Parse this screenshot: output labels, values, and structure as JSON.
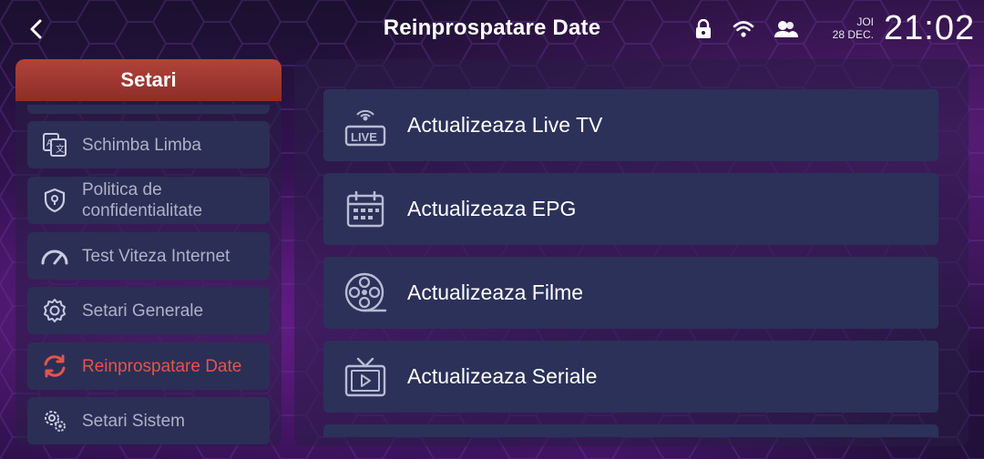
{
  "header": {
    "title": "Reinprospatare Date",
    "back_icon": "chevron-left-icon",
    "status_icons": [
      "lock-icon",
      "wifi-icon",
      "users-icon"
    ],
    "day": "JOI",
    "date": "28 DEC.",
    "time": "21:02"
  },
  "sidebar": {
    "title": "Setari",
    "items": [
      {
        "label": "Schimba Limba",
        "icon": "translate-icon"
      },
      {
        "label": "Politica de confidentialitate",
        "icon": "shield-lock-icon"
      },
      {
        "label": "Test Viteza Internet",
        "icon": "speedometer-icon"
      },
      {
        "label": "Setari Generale",
        "icon": "gear-icon"
      },
      {
        "label": "Reinprospatare Date",
        "icon": "refresh-icon",
        "active": true
      },
      {
        "label": "Setari Sistem",
        "icon": "settings-cog-icon"
      }
    ]
  },
  "main": {
    "actions": [
      {
        "label": "Actualizeaza Live TV",
        "icon": "live-tv-icon"
      },
      {
        "label": "Actualizeaza EPG",
        "icon": "calendar-icon"
      },
      {
        "label": "Actualizeaza Filme",
        "icon": "film-reel-icon"
      },
      {
        "label": "Actualizeaza Seriale",
        "icon": "tv-play-icon"
      }
    ]
  },
  "colors": {
    "accent_red": "#e2554a",
    "header_red": "#a83b33",
    "card_bg": "#2b3158",
    "text_muted": "#aeb2c8"
  }
}
